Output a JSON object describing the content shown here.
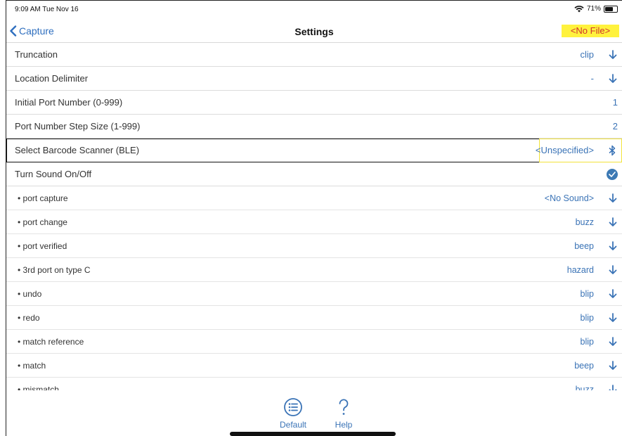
{
  "status": {
    "time": "9:09 AM  Tue Nov 16",
    "battery": "71%",
    "battery_level": 0.71
  },
  "nav": {
    "back_label": "Capture",
    "title": "Settings",
    "file_badge": "<No File>"
  },
  "settings": [
    {
      "label": "Truncation",
      "value": "clip"
    },
    {
      "label": "Location Delimiter",
      "value": "-"
    },
    {
      "label": "Initial Port Number (0-999)",
      "value": "1"
    },
    {
      "label": "Port Number Step Size (1-999)",
      "value": "2"
    },
    {
      "label": "Select Barcode Scanner (BLE)",
      "value": "<Unspecified>"
    },
    {
      "label": "Turn Sound On/Off",
      "value": "on"
    }
  ],
  "sounds": [
    {
      "label": "port capture",
      "value": "<No Sound>"
    },
    {
      "label": "port change",
      "value": "buzz"
    },
    {
      "label": "port verified",
      "value": "beep"
    },
    {
      "label": "3rd port on type C",
      "value": "hazard"
    },
    {
      "label": "undo",
      "value": "blip"
    },
    {
      "label": "redo",
      "value": "blip"
    },
    {
      "label": "match reference",
      "value": "blip"
    },
    {
      "label": "match",
      "value": "beep"
    },
    {
      "label": "mismatch",
      "value": "buzz"
    }
  ],
  "toolbar": {
    "default_label": "Default",
    "help_label": "Help"
  },
  "colors": {
    "accent": "#3a73b6",
    "highlight": "#fff23d",
    "badge_text": "#d0342c"
  }
}
